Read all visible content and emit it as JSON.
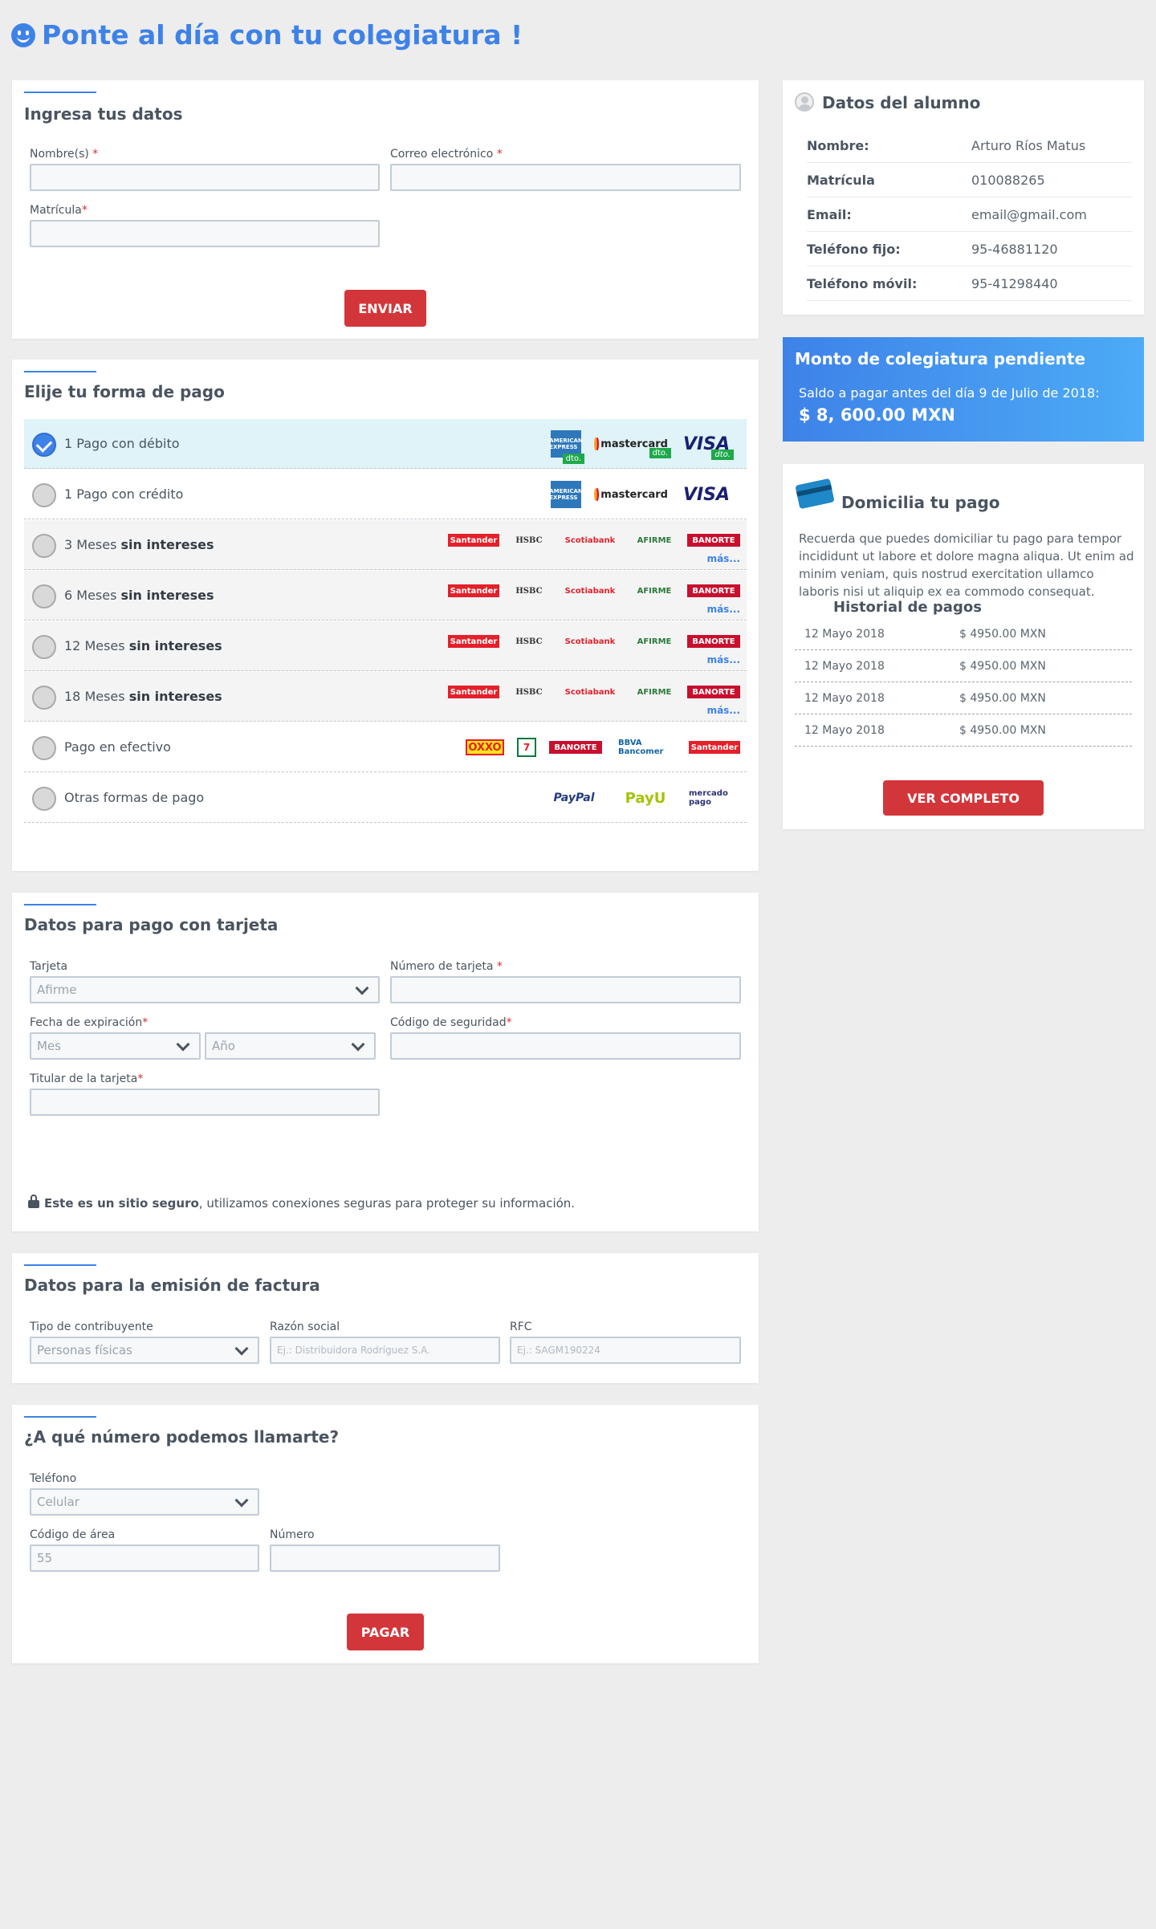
{
  "page_title": "Ponte al día con tu colegiatura !",
  "ingresa": {
    "title": "Ingresa tus datos",
    "nombre_label": "Nombre(s)",
    "correo_label": "Correo electrónico",
    "matricula_label": "Matrícula",
    "required_mark": "*",
    "enviar_label": "ENVIAR"
  },
  "forma_pago": {
    "title": "Elije tu forma de pago",
    "options": [
      {
        "prefix": "1 Pago con débito",
        "bold": ""
      },
      {
        "prefix": "1 Pago con crédito",
        "bold": ""
      },
      {
        "prefix": "3 Meses ",
        "bold": "sin intereses"
      },
      {
        "prefix": "6 Meses ",
        "bold": "sin intereses"
      },
      {
        "prefix": "12 Meses ",
        "bold": "sin intereses"
      },
      {
        "prefix": "18 Meses ",
        "bold": "sin intereses"
      },
      {
        "prefix": "Pago en efectivo",
        "bold": ""
      },
      {
        "prefix": "Otras formas de pago",
        "bold": ""
      }
    ],
    "selected_index": 0,
    "card_logos": {
      "amex": "AMERICAN EXPRESS",
      "mastercard": "mastercard",
      "visa": "VISA",
      "dto": "dto."
    },
    "bank_logos": {
      "santander": "Santander",
      "hsbc": "HSBC",
      "scotiabank": "Scotiabank",
      "afirme": "AFIRME",
      "banorte": "BANORTE",
      "mas": "más..."
    },
    "cash_logos": {
      "oxxo": "OXXO",
      "seven": "7",
      "banorte": "BANORTE",
      "bbva": "BBVA Bancomer",
      "santander": "Santander"
    },
    "other_logos": {
      "paypal": "PayPal",
      "payu": "PayU",
      "mercado": "mercado pago"
    }
  },
  "tarjeta": {
    "title": "Datos para pago con tarjeta",
    "tarjeta_label": "Tarjeta",
    "tarjeta_value": "Afirme",
    "numero_label": "Número de tarjeta",
    "fecha_label": "Fecha de expiración",
    "mes_value": "Mes",
    "anio_value": "Año",
    "codigo_label": "Código de seguridad",
    "titular_label": "Titular de la tarjeta",
    "secure_bold": "Este es un sitio seguro",
    "secure_rest": ", utilizamos conexiones seguras para proteger su información."
  },
  "factura": {
    "title": "Datos para la emisión de factura",
    "tipo_label": "Tipo de contribuyente",
    "tipo_value": "Personas físicas",
    "razon_label": "Razón social",
    "razon_placeholder": "Ej.: Distribuidora Rodríguez S.A.",
    "rfc_label": "RFC",
    "rfc_placeholder": "Ej.: SAGM190224"
  },
  "llamarte": {
    "title": "¿A qué número podemos llamarte?",
    "telefono_label": "Teléfono",
    "telefono_value": "Celular",
    "area_label": "Código de área",
    "area_value": "55",
    "numero_label": "Número",
    "pagar_label": "PAGAR"
  },
  "alumno": {
    "title": "Datos del alumno",
    "rows": [
      {
        "k": "Nombre:",
        "v": "Arturo Ríos Matus"
      },
      {
        "k": "Matrícula",
        "v": "010088265"
      },
      {
        "k": "Email:",
        "v": "email@gmail.com"
      },
      {
        "k": "Teléfono fijo:",
        "v": "95-46881120"
      },
      {
        "k": "Teléfono móvil:",
        "v": "95-41298440"
      }
    ]
  },
  "monto": {
    "title": "Monto de colegiatura pendiente",
    "subtitle": "Saldo a pagar antes del día 9 de Julio de 2018:",
    "amount": "$ 8, 600.00 MXN"
  },
  "domicilia": {
    "title": "Domicilia tu pago",
    "text": "Recuerda que puedes domiciliar tu pago para tempor incididunt ut labore et dolore magna aliqua. Ut enim ad minim veniam, quis nostrud exercitation ullamco laboris nisi ut aliquip ex ea commodo consequat.",
    "historial_title": "Historial de pagos",
    "historial": [
      {
        "d": "12 Mayo 2018",
        "m": "$ 4950.00 MXN"
      },
      {
        "d": "12 Mayo 2018",
        "m": "$ 4950.00 MXN"
      },
      {
        "d": "12 Mayo 2018",
        "m": "$ 4950.00 MXN"
      },
      {
        "d": "12 Mayo 2018",
        "m": "$ 4950.00 MXN"
      }
    ],
    "ver_label": "VER COMPLETO"
  },
  "colors": {
    "accent": "#3e82e8",
    "button": "#d3363a",
    "background": "#ededed"
  }
}
